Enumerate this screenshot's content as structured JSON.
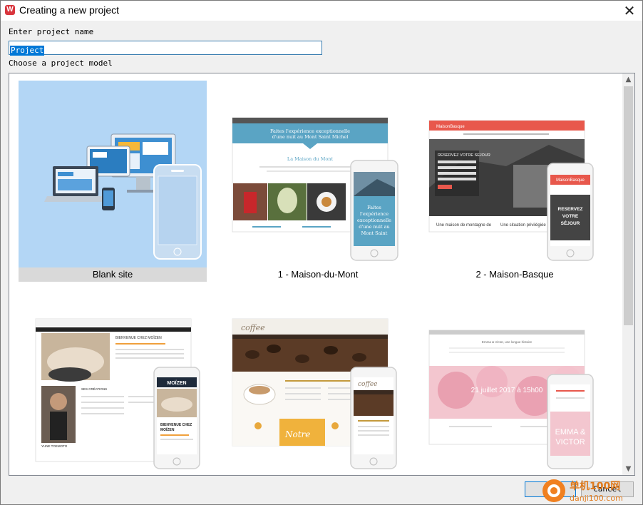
{
  "window": {
    "title": "Creating a new project",
    "close_glyph": "✕"
  },
  "form": {
    "name_label": "Enter project name",
    "name_value": "Project",
    "model_label": "Choose a project model"
  },
  "models": [
    {
      "label": "Blank site",
      "selected": true
    },
    {
      "label": "1 - Maison-du-Mont",
      "selected": false
    },
    {
      "label": "2 - Maison-Basque",
      "selected": false
    },
    {
      "label": "",
      "selected": false
    },
    {
      "label": "",
      "selected": false
    },
    {
      "label": "",
      "selected": false
    }
  ],
  "thumbnails": {
    "mont_banner": "Faites l'expérience exceptionnelle d'une nuit au Mont Saint Michel",
    "mont_heading": "La Maison du Mont",
    "mont_phone": "Faites l'expérience exceptionnelle d'une nuit au Mont Saint",
    "basque_brand": "MaisonBasque",
    "basque_hero": "RESERVEZ VOTRE SEJOUR",
    "basque_caption_left": "Une maison de montagne de",
    "basque_caption_right": "Une situation privilégiée",
    "basque_phone": "RESERVEZ VOTRE SÉJOUR",
    "moizen_brand": "MOÏZEN",
    "moizen_heading": "BIENVENUE CHEZ MOÏZEN",
    "moizen_creations": "SES CRÉATIONS",
    "moizen_name": "YUNE TOEMOTO",
    "coffee_brand": "coffee",
    "coffee_menu": "Notre",
    "wedding_title": "Emma & Victor, une longue histoire",
    "wedding_date": "21 juillet 2017 à 15h00",
    "wedding_names": "EMMA & VICTOR"
  },
  "buttons": {
    "ok": "OK",
    "cancel": "Cancel"
  },
  "scrollbar": {
    "up_glyph": "▲",
    "down_glyph": "▼"
  },
  "watermark": {
    "text1": "单机100网",
    "text2": "danji100.com"
  },
  "colors": {
    "selection_bg": "#b3d6f5",
    "accent": "#0078d7",
    "basque_red": "#e8584c",
    "mont_blue": "#5aa4c4"
  }
}
